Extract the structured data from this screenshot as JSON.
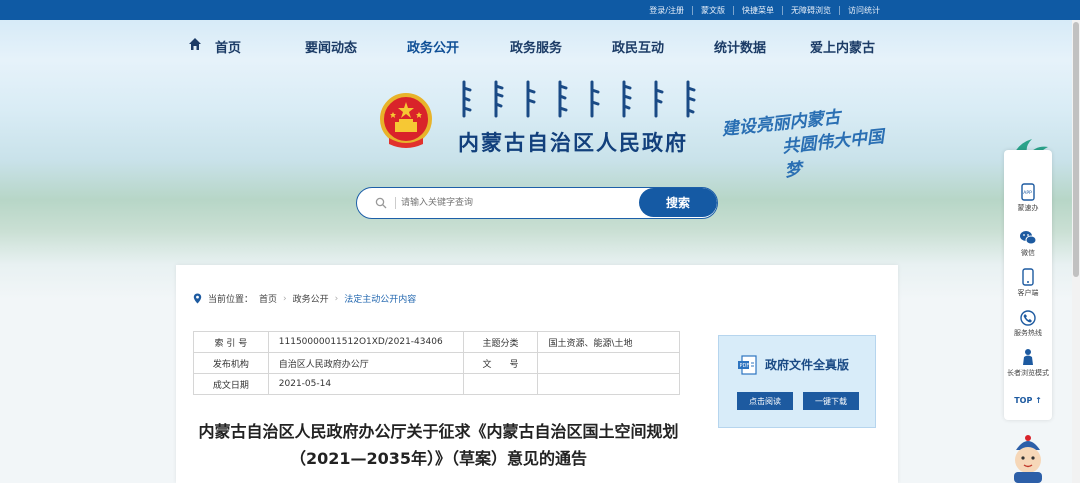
{
  "topbar": {
    "links": [
      "登录/注册",
      "蒙文版",
      "快捷菜单",
      "无障碍浏览",
      "访问统计"
    ]
  },
  "nav": {
    "items": [
      {
        "label": "首页",
        "icon": "home-icon"
      },
      {
        "label": "要闻动态"
      },
      {
        "label": "政务公开",
        "active": true
      },
      {
        "label": "政务服务"
      },
      {
        "label": "政民互动"
      },
      {
        "label": "统计数据"
      },
      {
        "label": "爱上内蒙古"
      }
    ]
  },
  "header": {
    "title": "内蒙古自治区人民政府",
    "slogan_line1": "建设亮丽内蒙古",
    "slogan_line2": "共圆伟大中国梦",
    "emblem_icon": "national-emblem-icon"
  },
  "search": {
    "placeholder": "请输入关键字查询",
    "button_label": "搜索"
  },
  "breadcrumb": {
    "prefix": "当前位置：",
    "items": [
      "首页",
      "政务公开",
      "法定主动公开内容"
    ]
  },
  "meta_table": {
    "rows": [
      {
        "k1": "索 引 号",
        "v1": "11150000011512O1XD/2021-43406",
        "k2": "主题分类",
        "v2": "国土资源、能源\\土地"
      },
      {
        "k1": "发布机构",
        "v1": "自治区人民政府办公厅",
        "k2": "文　　号",
        "v2": ""
      },
      {
        "k1": "成文日期",
        "v1": "2021-05-14",
        "k2": "",
        "v2": ""
      }
    ]
  },
  "document": {
    "title_line1": "内蒙古自治区人民政府办公厅关于征求《内蒙古自治区国土空间规划",
    "title_line2": "（2021—2035年）》（草案）意见的通告"
  },
  "fulltext_box": {
    "title": "政府文件全真版",
    "read_button": "点击阅读",
    "download_button": "一键下载"
  },
  "side_toolbar": {
    "items": [
      {
        "label": "蒙速办",
        "icon": "app-icon"
      },
      {
        "label": "微信",
        "icon": "wechat-icon"
      },
      {
        "label": "客户端",
        "icon": "mobile-icon"
      },
      {
        "label": "服务热线",
        "icon": "phone-icon"
      },
      {
        "label": "长者浏览模式",
        "icon": "elder-mode-icon"
      }
    ],
    "top_label": "TOP ↑"
  },
  "colors": {
    "brand_blue": "#0f5aa4",
    "nav_text": "#1b3b66",
    "title_blue": "#12407c"
  }
}
